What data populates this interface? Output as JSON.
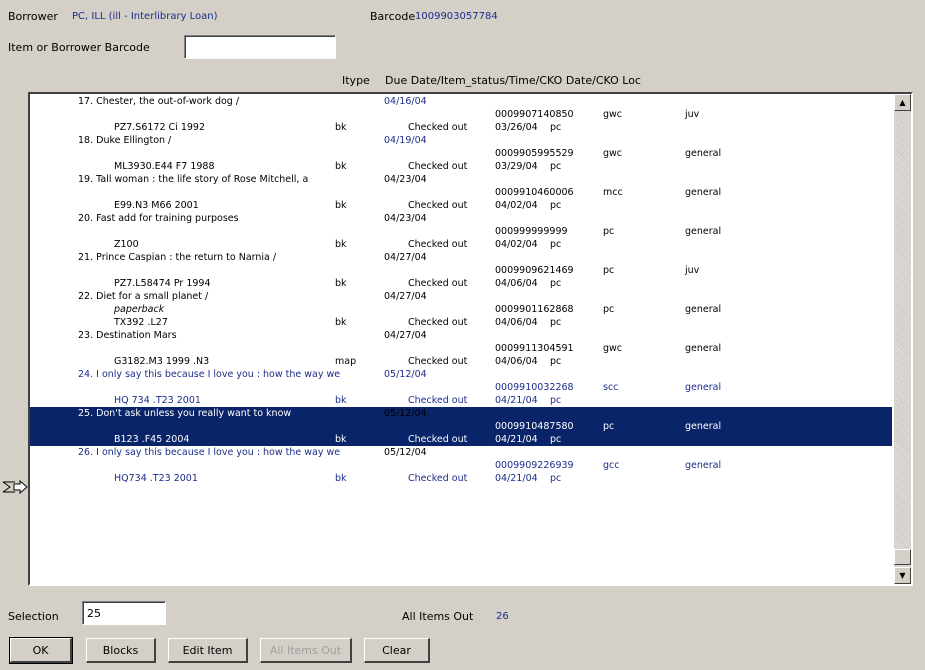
{
  "header": {
    "borrower_label": "Borrower",
    "borrower_value": "PC, ILL (ill - Interlibrary Loan)",
    "barcode_label": "Barcode",
    "barcode_value": "1009903057784",
    "item_barcode_label": "Item or Borrower Barcode",
    "item_barcode_value": ""
  },
  "columns": {
    "itype": "Itype",
    "due": "Due Date/Item_status/Time/CKO Date/CKO Loc"
  },
  "items": [
    {
      "title": "17. Chester, the out-of-work dog /",
      "due": "04/16/04",
      "due_blue": true,
      "note": "",
      "barcode": "0009907140850",
      "loc": "gwc",
      "coll": "juv",
      "call": "PZ7.S6172 Ci 1992",
      "itype": "bk",
      "status": "Checked out",
      "cko_date": "03/26/04",
      "cko_loc": "pc",
      "selected": false,
      "blue": false
    },
    {
      "title": "18. Duke Ellington /",
      "due": "04/19/04",
      "due_blue": true,
      "note": "",
      "barcode": "0009905995529",
      "loc": "gwc",
      "coll": "general",
      "call": "ML3930.E44 F7 1988",
      "itype": "bk",
      "status": "Checked out",
      "cko_date": "03/29/04",
      "cko_loc": "pc",
      "selected": false,
      "blue": false
    },
    {
      "title": "19. Tall woman : the life story of Rose Mitchell, a",
      "due": "04/23/04",
      "due_blue": false,
      "note": "",
      "barcode": "0009910460006",
      "loc": "mcc",
      "coll": "general",
      "call": "E99.N3 M66 2001",
      "itype": "bk",
      "status": "Checked out",
      "cko_date": "04/02/04",
      "cko_loc": "pc",
      "selected": false,
      "blue": false
    },
    {
      "title": "20. Fast add for training purposes",
      "due": "04/23/04",
      "due_blue": false,
      "note": "",
      "barcode": "000999999999",
      "loc": "pc",
      "coll": "general",
      "call": "Z100",
      "itype": "bk",
      "status": "Checked out",
      "cko_date": "04/02/04",
      "cko_loc": "pc",
      "selected": false,
      "blue": false
    },
    {
      "title": "21. Prince Caspian : the return to Narnia /",
      "due": "04/27/04",
      "due_blue": false,
      "note": "",
      "barcode": "0009909621469",
      "loc": "pc",
      "coll": "juv",
      "call": "PZ7.L58474 Pr 1994",
      "itype": "bk",
      "status": "Checked out",
      "cko_date": "04/06/04",
      "cko_loc": "pc",
      "selected": false,
      "blue": false
    },
    {
      "title": "22. Diet for a small planet /",
      "due": "04/27/04",
      "due_blue": false,
      "note": "paperback",
      "barcode": "0009901162868",
      "loc": "pc",
      "coll": "general",
      "call": "TX392 .L27",
      "itype": "bk",
      "status": "Checked out",
      "cko_date": "04/06/04",
      "cko_loc": "pc",
      "selected": false,
      "blue": false
    },
    {
      "title": "23. Destination Mars",
      "due": "04/27/04",
      "due_blue": false,
      "note": "",
      "barcode": "0009911304591",
      "loc": "gwc",
      "coll": "general",
      "call": "G3182.M3 1999 .N3",
      "itype": "map",
      "status": "Checked out",
      "cko_date": "04/06/04",
      "cko_loc": "pc",
      "selected": false,
      "blue": false
    },
    {
      "title": "24. I only say this because I love you : how the way we",
      "due": "05/12/04",
      "due_blue": true,
      "note": "",
      "barcode": "0009910032268",
      "loc": "scc",
      "coll": "general",
      "call": "HQ 734 .T23 2001",
      "itype": "bk",
      "status": "Checked out",
      "cko_date": "04/21/04",
      "cko_loc": "pc",
      "selected": false,
      "blue": true
    },
    {
      "title": "25. Don't ask unless you really want to know",
      "due": "05/12/04",
      "due_blue": false,
      "note": "",
      "barcode": "0009910487580",
      "loc": "pc",
      "coll": "general",
      "call": "B123 .F45 2004",
      "itype": "bk",
      "status": "Checked out",
      "cko_date": "04/21/04",
      "cko_loc": "pc",
      "selected": true,
      "blue": false
    },
    {
      "title": "26. I only say this because I love you : how the way we",
      "due": "05/12/04",
      "due_blue": false,
      "note": "",
      "barcode": "0009909226939",
      "loc": "gcc",
      "coll": "general",
      "call": "HQ734 .T23 2001",
      "itype": "bk",
      "status": "Checked out",
      "cko_date": "04/21/04",
      "cko_loc": "pc",
      "selected": false,
      "blue": true
    }
  ],
  "footer": {
    "selection_label": "Selection",
    "selection_value": "25",
    "all_items_label": "All Items Out",
    "all_items_count": "26"
  },
  "buttons": {
    "ok": "OK",
    "blocks": "Blocks",
    "edit_item": "Edit Item",
    "all_items_out": "All Items Out",
    "clear": "Clear"
  },
  "colors": {
    "accent": "#1c2d8a",
    "selection": "#0a246a",
    "window": "#d4d0c8"
  },
  "icons": {
    "pointer": "selection-pointer-icon",
    "scroll_up": "arrow-up-icon",
    "scroll_down": "arrow-down-icon"
  }
}
